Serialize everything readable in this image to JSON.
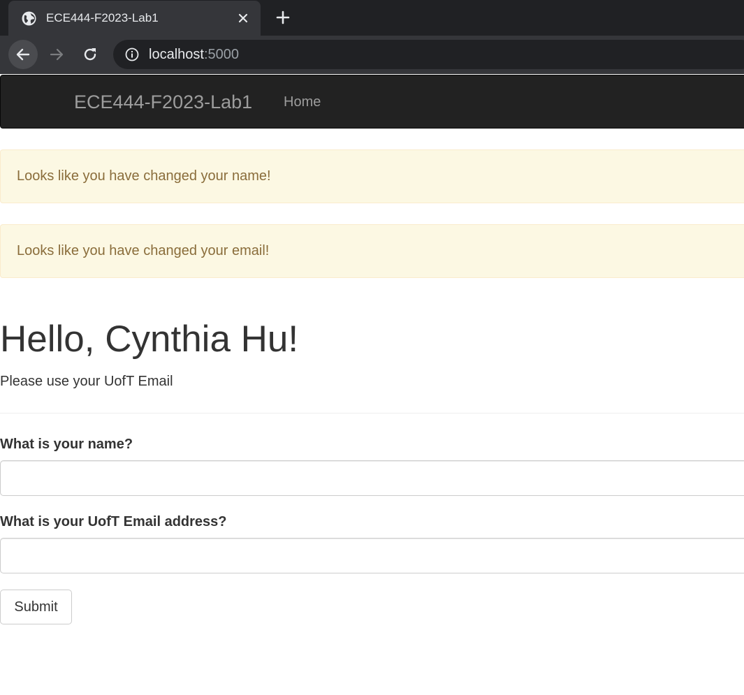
{
  "browser": {
    "tab_title": "ECE444-F2023-Lab1",
    "url_host": "localhost",
    "url_port": ":5000"
  },
  "navbar": {
    "brand": "ECE444-F2023-Lab1",
    "home_label": "Home"
  },
  "alerts": [
    "Looks like you have changed your name!",
    "Looks like you have changed your email!"
  ],
  "page": {
    "greeting": "Hello, Cynthia Hu!",
    "subtext": "Please use your UofT Email"
  },
  "form": {
    "name_label": "What is your name?",
    "name_value": "",
    "email_label": "What is your UofT Email address?",
    "email_value": "",
    "submit_label": "Submit"
  },
  "colors": {
    "navbar_bg": "#222222",
    "alert_bg": "#fcf8e3",
    "alert_text": "#8a6d3b"
  }
}
